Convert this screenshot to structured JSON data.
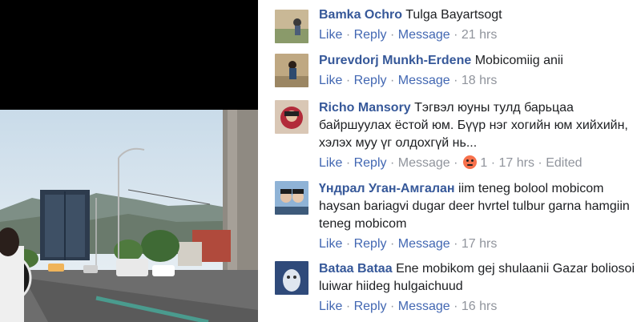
{
  "comments": [
    {
      "author": "Bamka Ochro",
      "text": "Tulga Bayartsogt",
      "actions": {
        "like": "Like",
        "reply": "Reply",
        "message": "Message"
      },
      "time": "21 hrs",
      "avatar": "avatar-photo"
    },
    {
      "author": "Purevdorj Munkh-Erdene",
      "text": "Mobicomiig anii",
      "actions": {
        "like": "Like",
        "reply": "Reply",
        "message": "Message"
      },
      "time": "18 hrs",
      "avatar": "avatar-photo"
    },
    {
      "author": "Richo Mansory",
      "text": "Тэгвэл юуны тулд барьцаа байршуулах ёстой юм. Бүүр нэг хогийн юм хийхийн, хэлэх муу үг олдохгүй нь...",
      "actions": {
        "like": "Like",
        "reply": "Reply",
        "message": "Message"
      },
      "reaction_icon": "angry-reaction-icon",
      "reaction_count": "1",
      "time": "17 hrs",
      "edited": "Edited",
      "avatar": "avatar-photo"
    },
    {
      "author": "Үндрал Уган-Амгалан",
      "text": "iim teneg bolool mobicom haysan bariagvi dugar deer hvrtel tulbur garna hamgiin teneg mobicom",
      "actions": {
        "like": "Like",
        "reply": "Reply",
        "message": "Message"
      },
      "time": "17 hrs",
      "avatar": "avatar-photo"
    },
    {
      "author": "Bataa Bataa",
      "text": "Ene mobikom gej shulaanii Gazar boliosoi luiwar hiideg hulgaichuud",
      "actions": {
        "like": "Like",
        "reply": "Reply",
        "message": "Message"
      },
      "time": "16 hrs",
      "avatar": "avatar-photo"
    }
  ],
  "colors": {
    "author": "#365899",
    "action": "#4267b2",
    "meta": "#90949c",
    "text": "#1c1e21"
  }
}
